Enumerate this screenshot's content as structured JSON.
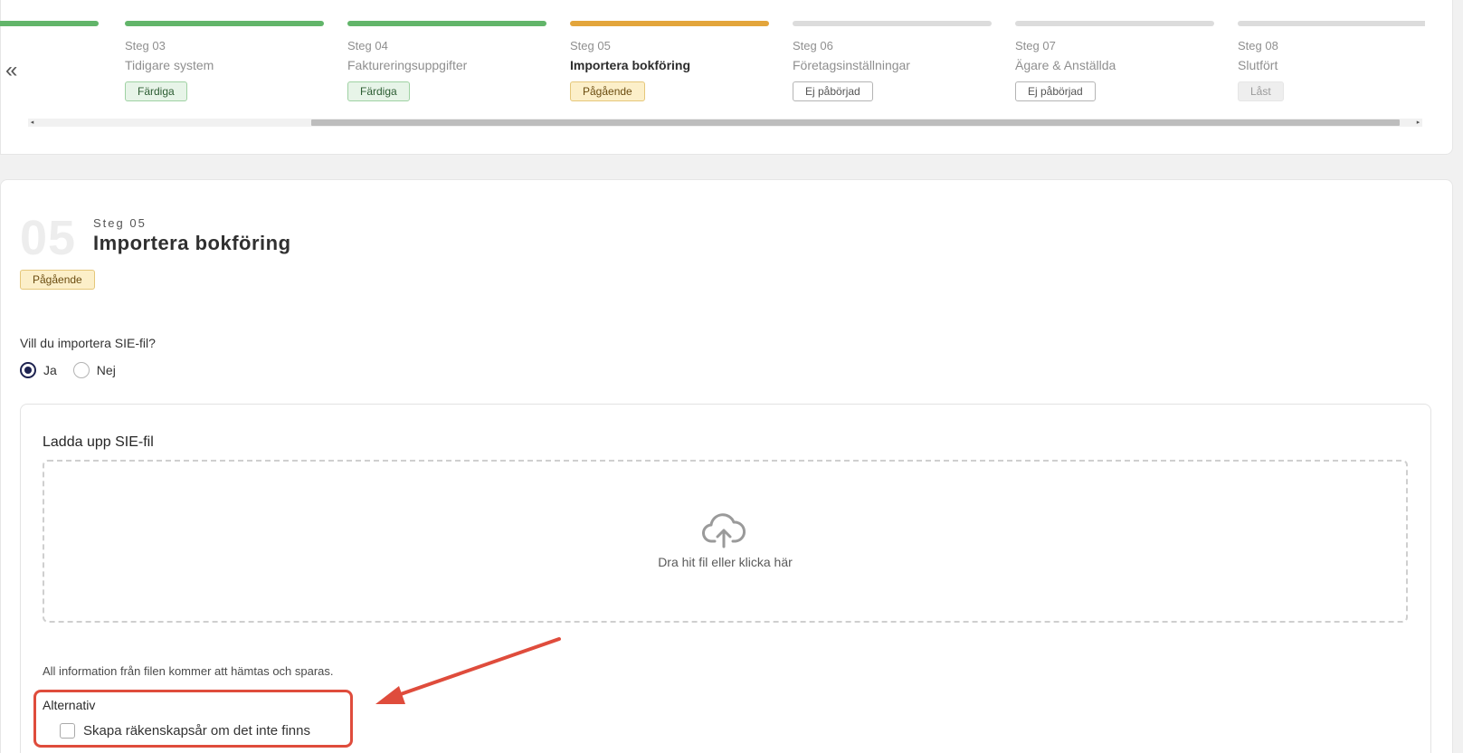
{
  "nav": {
    "collapse_icon": "«"
  },
  "steps": [
    {
      "number": "",
      "title": "",
      "status": "done",
      "badge": ""
    },
    {
      "number": "Steg 03",
      "title": "Tidigare system",
      "status": "done",
      "badge": "Färdiga"
    },
    {
      "number": "Steg 04",
      "title": "Faktureringsuppgifter",
      "status": "done",
      "badge": "Färdiga"
    },
    {
      "number": "Steg 05",
      "title": "Importera bokföring",
      "status": "active",
      "badge": "Pågående"
    },
    {
      "number": "Steg 06",
      "title": "Företagsinställningar",
      "status": "todo",
      "badge": "Ej påbörjad"
    },
    {
      "number": "Steg 07",
      "title": "Ägare & Anställda",
      "status": "todo",
      "badge": "Ej påbörjad"
    },
    {
      "number": "Steg 08",
      "title": "Slutfört",
      "status": "locked",
      "badge": "Låst"
    }
  ],
  "scrollbar": {
    "left_arrow": "◂",
    "right_arrow": "▸"
  },
  "main": {
    "big_number": "05",
    "step_label": "Steg 05",
    "title": "Importera bokföring",
    "status_badge": "Pågående",
    "question": "Vill du importera SIE-fil?",
    "radio_options": [
      {
        "label": "Ja",
        "selected": true
      },
      {
        "label": "Nej",
        "selected": false
      }
    ],
    "upload": {
      "title": "Ladda upp SIE-fil",
      "dropzone_icon": "cloud-upload-icon",
      "dropzone_text": "Dra hit fil eller klicka här",
      "info": "All information från filen kommer att hämtas och sparas.",
      "options_label": "Alternativ",
      "checkbox_label": "Skapa räkenskapsår om det inte finns",
      "checkbox_checked": false
    }
  },
  "colors": {
    "done": "#62b56a",
    "active": "#e3a53b",
    "todo": "#dcdcdc",
    "annotation": "#df4c3c"
  }
}
